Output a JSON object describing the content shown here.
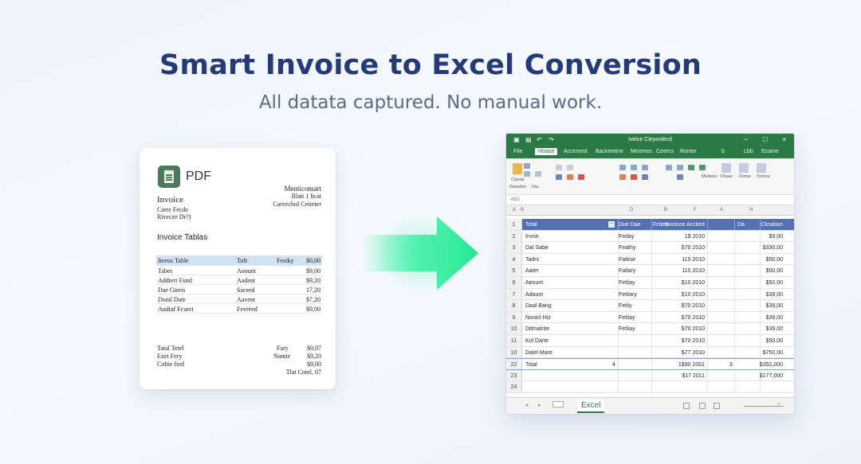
{
  "hero": {
    "title": "Smart Invoice to Excel Conversion",
    "subtitle": "All datata captured. No manual work."
  },
  "pdf": {
    "icon": "document-icon",
    "label": "PDF",
    "doc_title": "Invoice",
    "left_lines": [
      "Carre Fecde",
      "Rivecze Dr?)"
    ],
    "right_lines": [
      "Menticomart",
      "Blatt 1 licat",
      "Carvecbol Ceterter"
    ],
    "section_title": "Invoice Tablas",
    "table_header": [
      "Iteeus Table",
      "Toft",
      "Festky",
      "$0,00"
    ],
    "table_rows": [
      [
        "Tabes",
        "Aoount",
        "",
        "$9,00"
      ],
      [
        "Addtert Fund",
        "Aadent",
        "",
        "$9,20"
      ],
      [
        "Dae Gteris",
        "Saceed",
        "",
        "17,20"
      ],
      [
        "Dond Date",
        "Aavent",
        "",
        "$7,20"
      ],
      [
        "Audtaf Fcueri",
        "Fevreed",
        "",
        "$9,00"
      ]
    ],
    "footer_left": [
      "Tatal Tetel",
      "Exet Fery",
      "Coltie fted"
    ],
    "footer_mid": [
      "Fary",
      "Namie"
    ],
    "footer_right": [
      "$9,07",
      "$9,20",
      "$9,00",
      "Tlat Cotel, 07"
    ]
  },
  "excel": {
    "window_title": "Iveice Cleyonlecd",
    "tabs": [
      "File",
      "Hoase",
      "Accenerd",
      "Backmeine",
      "Meomes",
      "Ceercs",
      "Ronter",
      "b",
      "Lbb",
      "Ecame"
    ],
    "active_tab": "Hoase",
    "ribbon_labels": [
      "Clacial",
      "Gwaslex",
      "Dia",
      "Meitees",
      "Shaae",
      "Dome",
      "Tomne"
    ],
    "name_box": "A51",
    "columns": [
      "A",
      "B",
      "D",
      "B",
      "F",
      "A",
      "H"
    ],
    "rows": [
      {
        "n": "1",
        "a": "Total",
        "b": "Due Dae",
        "c": "Fctiert",
        "d": "Invoicce Acclont",
        "e": "Da",
        "f": "Cknation"
      },
      {
        "n": "2",
        "a": "Irvcie",
        "b": "Feday",
        "c": "",
        "d": "1$ 2010",
        "e": "",
        "f": "$9,00"
      },
      {
        "n": "3",
        "a": "Dal Sabe",
        "b": "Feathy",
        "c": "",
        "d": "$70 2010",
        "e": "",
        "f": "$330,00"
      },
      {
        "n": "4",
        "a": "Tadrs",
        "b": "Fatkse",
        "c": "",
        "d": "115 2010",
        "e": "",
        "f": "$50,00"
      },
      {
        "n": "5",
        "a": "Aater",
        "b": "Fatlary",
        "c": "",
        "d": "115 2010",
        "e": "",
        "f": "$50,00"
      },
      {
        "n": "6",
        "a": "Aeount",
        "b": "Fetliay",
        "c": "",
        "d": "$10 2010",
        "e": "",
        "f": "$50,00"
      },
      {
        "n": "7",
        "a": "Adaunt",
        "b": "Fetliary",
        "c": "",
        "d": "$10 2010",
        "e": "",
        "f": "$39,00"
      },
      {
        "n": "8",
        "a": "Daal Bang",
        "b": "Fetliy",
        "c": "",
        "d": "$70 2010",
        "e": "",
        "f": "$39,00"
      },
      {
        "n": "9",
        "a": "Nooict Hiz",
        "b": "Fetliay",
        "c": "",
        "d": "$70 2010",
        "e": "",
        "f": "$39,00"
      },
      {
        "n": "10",
        "a": "Ddmalnte",
        "b": "Fetliay",
        "c": "",
        "d": "$70 2010",
        "e": "",
        "f": "$39,00"
      },
      {
        "n": "11",
        "a": "Kol Darte",
        "b": "",
        "c": "",
        "d": "$70 2010",
        "e": "",
        "f": "$50,00"
      },
      {
        "n": "10",
        "a": "Dalel Mare",
        "b": "",
        "c": "",
        "d": "$77 2010",
        "e": "",
        "f": "$750,00"
      },
      {
        "n": "22",
        "a": "Total",
        "b": "4",
        "c": "",
        "d": "1$90 2001",
        "e": "3",
        "f": "$352,000"
      },
      {
        "n": "23",
        "a": "",
        "b": "",
        "c": "",
        "d": "$17 2011",
        "e": "",
        "f": "$177,000"
      },
      {
        "n": "24",
        "a": "",
        "b": "",
        "c": "",
        "d": "",
        "e": "",
        "f": ""
      }
    ],
    "sheet_tab": "Excel"
  },
  "colors": {
    "title": "#253a78",
    "excel_green": "#2b7a45",
    "header_blue": "#5570b0",
    "arrow": "#2ef0a0"
  }
}
